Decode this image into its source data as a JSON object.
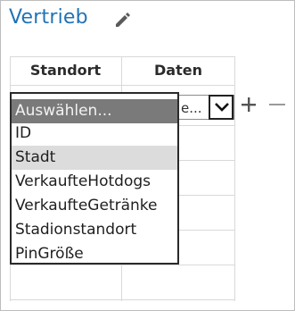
{
  "title": "Vertrieb",
  "icons": {
    "edit": "pencil-icon",
    "add": "plus-icon",
    "remove": "minus-icon",
    "dropdown": "chevron-down-icon"
  },
  "table": {
    "headers": [
      "Standort",
      "Daten"
    ]
  },
  "combo": {
    "value_truncated": "e..."
  },
  "dropdown": {
    "options": [
      "Auswählen...",
      "ID",
      "Stadt",
      "VerkaufteHotdogs",
      "VerkaufteGetränke",
      "Stadionstandort",
      "PinGröße"
    ],
    "selected": "Auswählen...",
    "hovered": "Stadt"
  },
  "colors": {
    "title": "#1f73b7",
    "selected_bg": "#7a7a7a",
    "hover_bg": "#dcdcdc"
  }
}
